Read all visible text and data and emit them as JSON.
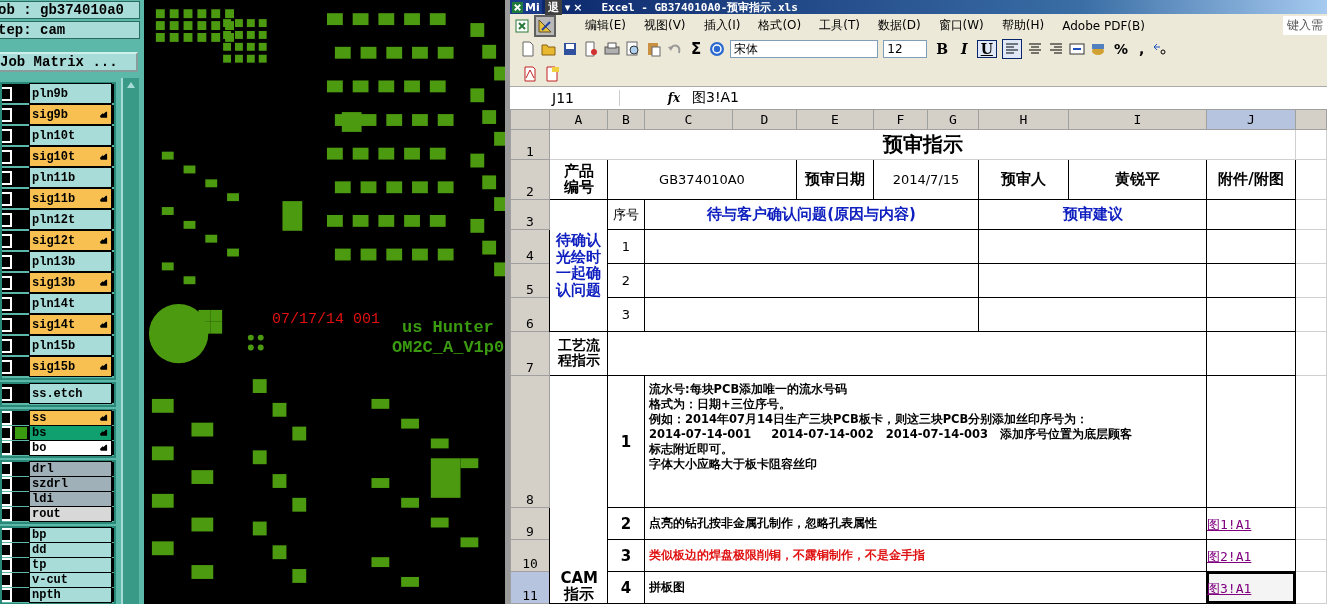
{
  "cam_panel": {
    "job": "ob : gb374010a0",
    "step": "tep: cam",
    "matrix_button": "Job Matrix ...",
    "layer_groups": [
      {
        "kind": "tall",
        "layers": [
          {
            "name": "pln9b",
            "color": "#a8dcd8",
            "affected": false,
            "displayed": false,
            "checked": false
          },
          {
            "name": "sig9b",
            "color": "#f8c050",
            "affected": true,
            "displayed": false,
            "checked": false
          },
          {
            "name": "pln10t",
            "color": "#a8dcd8",
            "affected": false,
            "displayed": false,
            "checked": false
          },
          {
            "name": "sig10t",
            "color": "#f8c050",
            "affected": true,
            "displayed": false,
            "checked": false
          },
          {
            "name": "pln11b",
            "color": "#a8dcd8",
            "affected": false,
            "displayed": false,
            "checked": false
          },
          {
            "name": "sig11b",
            "color": "#f8c050",
            "affected": true,
            "displayed": false,
            "checked": false
          },
          {
            "name": "pln12t",
            "color": "#a8dcd8",
            "affected": false,
            "displayed": false,
            "checked": false
          },
          {
            "name": "sig12t",
            "color": "#f8c050",
            "affected": true,
            "displayed": false,
            "checked": false
          },
          {
            "name": "pln13b",
            "color": "#a8dcd8",
            "affected": false,
            "displayed": false,
            "checked": false
          },
          {
            "name": "sig13b",
            "color": "#f8c050",
            "affected": true,
            "displayed": false,
            "checked": false
          },
          {
            "name": "pln14t",
            "color": "#a8dcd8",
            "affected": false,
            "displayed": false,
            "checked": false
          },
          {
            "name": "sig14t",
            "color": "#f8c050",
            "affected": true,
            "displayed": false,
            "checked": false
          },
          {
            "name": "pln15b",
            "color": "#a8dcd8",
            "affected": false,
            "displayed": false,
            "checked": false
          },
          {
            "name": "sig15b",
            "color": "#f8c050",
            "affected": true,
            "displayed": false,
            "checked": false
          }
        ]
      },
      {
        "kind": "tall",
        "layers": [
          {
            "name": "ss.etch",
            "color": "#a8dcd8",
            "affected": false,
            "displayed": false,
            "checked": false
          }
        ]
      },
      {
        "kind": "short",
        "layers": [
          {
            "name": "ss",
            "color": "#f8c050",
            "affected": true,
            "displayed": false,
            "checked": false
          },
          {
            "name": "bs",
            "color": "#10a070",
            "affected": true,
            "displayed": true,
            "checked": false
          },
          {
            "name": "bo",
            "color": "#ffffff",
            "affected": true,
            "displayed": false,
            "checked": false
          }
        ]
      },
      {
        "kind": "short",
        "layers": [
          {
            "name": "drl",
            "color": "#a0b0b8",
            "affected": false,
            "displayed": false,
            "checked": false
          },
          {
            "name": "szdrl",
            "color": "#a0b0b8",
            "affected": false,
            "displayed": false,
            "checked": false
          },
          {
            "name": "ldi",
            "color": "#a0b0b8",
            "affected": false,
            "displayed": false,
            "checked": false
          },
          {
            "name": "rout",
            "color": "#d8d8d8",
            "affected": false,
            "displayed": false,
            "checked": false
          }
        ]
      },
      {
        "kind": "short",
        "layers": [
          {
            "name": "bp",
            "color": "#a8dcd8",
            "affected": false,
            "displayed": false,
            "checked": false
          },
          {
            "name": "dd",
            "color": "#a8dcd8",
            "affected": false,
            "displayed": false,
            "checked": false
          },
          {
            "name": "tp",
            "color": "#a8dcd8",
            "affected": false,
            "displayed": false,
            "checked": false
          },
          {
            "name": "v-cut",
            "color": "#a8dcd8",
            "affected": false,
            "displayed": false,
            "checked": false
          },
          {
            "name": "npth",
            "color": "#a8dcd8",
            "affected": false,
            "displayed": false,
            "checked": false
          }
        ]
      }
    ]
  },
  "board_view": {
    "date_mark": "07/17/14 001",
    "label_1": "us Hunter",
    "label_2": "OM2C_A_V1p0"
  },
  "excel": {
    "app_tab": "Mi",
    "float_tab": "退",
    "float_caret": "▾",
    "float_close": "×",
    "title": "Excel - GB374010A0-预审指示.xls",
    "menu": [
      "编辑(E)",
      "视图(V)",
      "插入(I)",
      "格式(O)",
      "工具(T)",
      "数据(D)",
      "窗口(W)",
      "帮助(H)",
      "Adobe PDF(B)"
    ],
    "help_box": "键入需",
    "toolbar": {
      "sum": "Σ",
      "font": "宋体",
      "size": "12",
      "styles": [
        {
          "label": "B",
          "selected": false
        },
        {
          "label": "I",
          "selected": false
        },
        {
          "label": "U",
          "selected": true
        }
      ],
      "align_left_selected": true,
      "percent": "%",
      "comma": ","
    },
    "name_box": "J11",
    "fx": "fx",
    "formula": "图3!A1",
    "columns": [
      {
        "label": "A",
        "selected": false
      },
      {
        "label": "B",
        "selected": false
      },
      {
        "label": "C",
        "selected": false
      },
      {
        "label": "D",
        "selected": false
      },
      {
        "label": "E",
        "selected": false
      },
      {
        "label": "F",
        "selected": false
      },
      {
        "label": "G",
        "selected": false
      },
      {
        "label": "H",
        "selected": false
      },
      {
        "label": "I",
        "selected": false
      },
      {
        "label": "J",
        "selected": true
      }
    ],
    "row_numbers": [
      {
        "label": "1",
        "selected": false
      },
      {
        "label": "2",
        "selected": false
      },
      {
        "label": "3",
        "selected": false
      },
      {
        "label": "4",
        "selected": false
      },
      {
        "label": "5",
        "selected": false
      },
      {
        "label": "6",
        "selected": false
      },
      {
        "label": "7",
        "selected": false
      },
      {
        "label": "8",
        "selected": false
      },
      {
        "label": "9",
        "selected": false
      },
      {
        "label": "10",
        "selected": false
      },
      {
        "label": "11",
        "selected": true
      }
    ],
    "form": {
      "title": "预审指示",
      "product_label": "产品编号",
      "product_code": "GB374010A0",
      "date_label": "预审日期",
      "date": "2014/7/15",
      "reviewer_label": "预审人",
      "reviewer": "黄锐平",
      "attachment_label": "附件/附图",
      "confirm_label": "待确认光绘时一起确认问题",
      "seq_header": "序号",
      "question_header": "待与客户确认问题(原因与内容)",
      "advice_header": "预审建议",
      "question_numbers": [
        "1",
        "2",
        "3"
      ],
      "process_label": "工艺流程指示",
      "cam_label": "CAM指示",
      "cam_items": [
        {
          "number": "1",
          "lines": [
            "流水号:每块PCB添加唯一的流水号码",
            "格式为：日期+三位序号。",
            "例如：2014年07月14日生产三块PCB板卡，则这三块PCB分别添加丝印序号为：",
            "2014-07-14-001     2014-07-14-002   2014-07-14-003   添加序号位置为底层顾客",
            "标志附近即可。",
            "字体大小应略大于板卡阻容丝印"
          ],
          "highlight": false,
          "selected": false
        },
        {
          "number": "2",
          "lines": [
            "点亮的钻孔按非金属孔制作，忽略孔表属性"
          ],
          "highlight": false,
          "link": "图1!A1",
          "selected": false
        },
        {
          "number": "3",
          "lines": [
            "类似板边的焊盘极限削铜，不露铜制作，不是金手指"
          ],
          "highlight": true,
          "link": "图2!A1",
          "selected": false
        },
        {
          "number": "4",
          "lines": [
            "拼板图"
          ],
          "highlight": false,
          "link": "图3!A1",
          "selected": true
        }
      ]
    }
  }
}
